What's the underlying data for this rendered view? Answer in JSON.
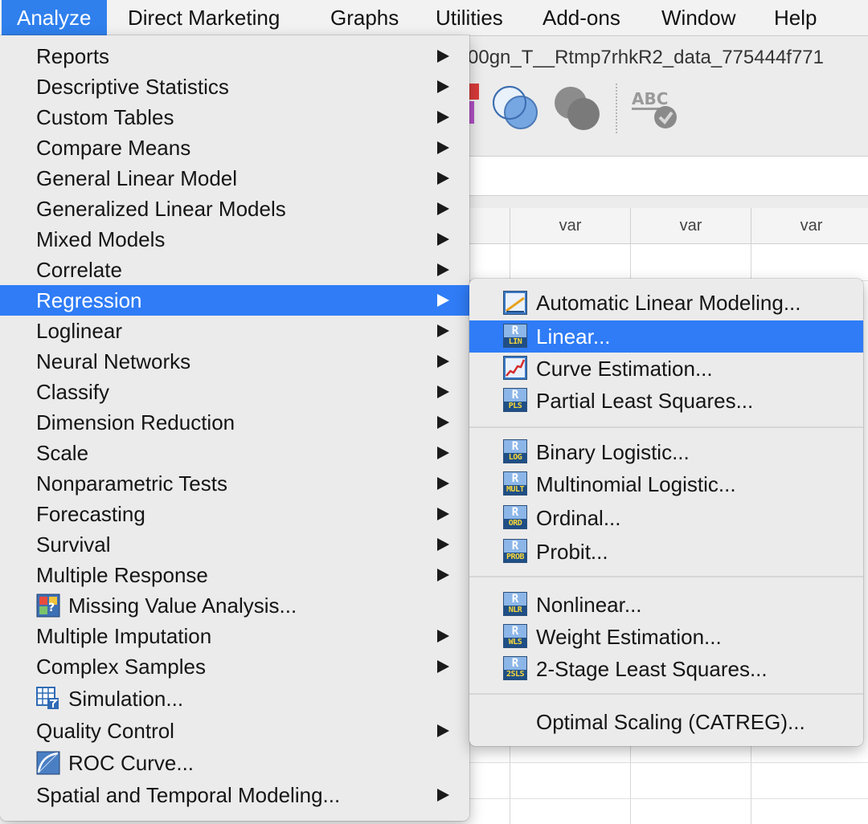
{
  "menubar": {
    "items": [
      "Analyze",
      "Direct Marketing",
      "Graphs",
      "Utilities",
      "Add-ons",
      "Window",
      "Help"
    ],
    "active": "Analyze"
  },
  "window": {
    "title": "00gn_T__Rtmp7rhkR2_data_775444f771",
    "grid": {
      "column_headers": [
        "var",
        "var",
        "var"
      ]
    }
  },
  "analyze_menu": {
    "items": [
      {
        "label": "Reports",
        "submenu": true
      },
      {
        "label": "Descriptive Statistics",
        "submenu": true
      },
      {
        "label": "Custom Tables",
        "submenu": true
      },
      {
        "label": "Compare Means",
        "submenu": true
      },
      {
        "label": "General Linear Model",
        "submenu": true
      },
      {
        "label": "Generalized Linear Models",
        "submenu": true
      },
      {
        "label": "Mixed Models",
        "submenu": true
      },
      {
        "label": "Correlate",
        "submenu": true
      },
      {
        "label": "Regression",
        "submenu": true,
        "highlighted": true
      },
      {
        "label": "Loglinear",
        "submenu": true
      },
      {
        "label": "Neural Networks",
        "submenu": true
      },
      {
        "label": "Classify",
        "submenu": true
      },
      {
        "label": "Dimension Reduction",
        "submenu": true
      },
      {
        "label": "Scale",
        "submenu": true
      },
      {
        "label": "Nonparametric Tests",
        "submenu": true
      },
      {
        "label": "Forecasting",
        "submenu": true
      },
      {
        "label": "Survival",
        "submenu": true
      },
      {
        "label": "Multiple Response",
        "submenu": true
      },
      {
        "label": "Missing Value Analysis...",
        "icon": "missing-value-icon"
      },
      {
        "label": "Multiple Imputation",
        "submenu": true
      },
      {
        "label": "Complex Samples",
        "submenu": true
      },
      {
        "label": "Simulation...",
        "icon": "simulation-icon"
      },
      {
        "label": "Quality Control",
        "submenu": true
      },
      {
        "label": "ROC Curve...",
        "icon": "roc-curve-icon"
      },
      {
        "label": "Spatial and Temporal Modeling...",
        "submenu": true
      }
    ]
  },
  "regression_menu": {
    "groups": [
      [
        {
          "label": "Automatic Linear Modeling...",
          "icon": "automatic-linear-icon"
        },
        {
          "label": "Linear...",
          "icon": "R",
          "code": "LIN",
          "highlighted": true
        },
        {
          "label": "Curve Estimation...",
          "icon": "curve-estimation-icon"
        },
        {
          "label": "Partial Least Squares...",
          "icon": "R",
          "code": "PLS"
        }
      ],
      [
        {
          "label": "Binary Logistic...",
          "icon": "R",
          "code": "LOG"
        },
        {
          "label": "Multinomial Logistic...",
          "icon": "R",
          "code": "MULT"
        },
        {
          "label": "Ordinal...",
          "icon": "R",
          "code": "ORD"
        },
        {
          "label": "Probit...",
          "icon": "R",
          "code": "PROB"
        }
      ],
      [
        {
          "label": "Nonlinear...",
          "icon": "R",
          "code": "NLR"
        },
        {
          "label": "Weight Estimation...",
          "icon": "R",
          "code": "WLS"
        },
        {
          "label": "2-Stage Least Squares...",
          "icon": "R",
          "code": "2SLS"
        }
      ],
      [
        {
          "label": "Optimal Scaling (CATREG)..."
        }
      ]
    ]
  },
  "colors": {
    "highlight": "#2f7cf6",
    "menu_background": "#ebebeb",
    "menubar_active": "#2f80ed"
  }
}
